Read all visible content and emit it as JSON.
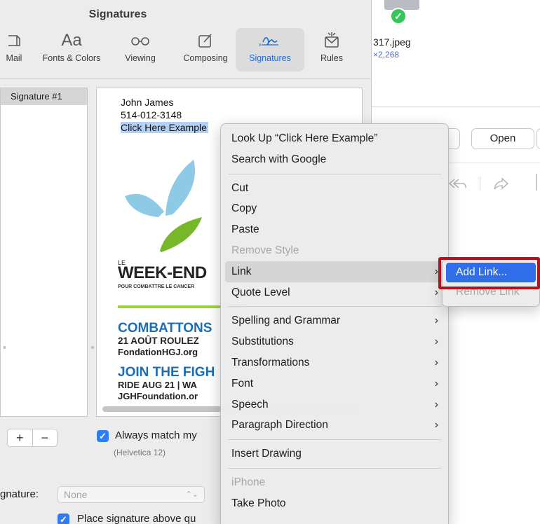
{
  "background": {
    "file_name": "317.jpeg",
    "file_dims": "×2,268",
    "open_button": "Open"
  },
  "prefs": {
    "title": "Signatures",
    "toolbar": {
      "mail": "Mail",
      "fonts": "Fonts & Colors",
      "viewing": "Viewing",
      "composing": "Composing",
      "signatures": "Signatures",
      "rules": "Rules"
    },
    "sig_list": [
      "Signature #1"
    ],
    "signature": {
      "name": "John James",
      "phone": "514-012-3148",
      "link_text": "Click Here Example"
    },
    "logo": {
      "le": "LE",
      "weekend": "WEEK-END",
      "pour": "POUR COMBATTRE LE CANCER",
      "combattons": "COMBATTONS",
      "aout": "21 AOÛT ROULEZ",
      "fondation": "FondationHGJ.org",
      "join": "JOIN THE FIGH",
      "ride": "RIDE AUG 21 | WA",
      "jgh": "JGHFoundation.or"
    },
    "list_buttons": {
      "add": "+",
      "remove": "−"
    },
    "always_match": {
      "label": "Always match my",
      "sub": "(Helvetica 12)",
      "checked": true
    },
    "choose": {
      "label": "gnature:",
      "value": "None"
    },
    "place_above": {
      "label": "Place signature above qu",
      "checked": true
    }
  },
  "context_menu": {
    "items": [
      {
        "label": "Look Up “Click Here Example”"
      },
      {
        "label": "Search with Google"
      },
      {
        "sep": true
      },
      {
        "label": "Cut"
      },
      {
        "label": "Copy"
      },
      {
        "label": "Paste"
      },
      {
        "label": "Remove Style",
        "disabled": true
      },
      {
        "label": "Link",
        "submenu": true,
        "highlighted": true
      },
      {
        "label": "Quote Level",
        "submenu": true
      },
      {
        "sep": true
      },
      {
        "label": "Spelling and Grammar",
        "submenu": true
      },
      {
        "label": "Substitutions",
        "submenu": true
      },
      {
        "label": "Transformations",
        "submenu": true
      },
      {
        "label": "Font",
        "submenu": true
      },
      {
        "label": "Speech",
        "submenu": true
      },
      {
        "label": "Paragraph Direction",
        "submenu": true
      },
      {
        "sep": true
      },
      {
        "label": "Insert Drawing"
      },
      {
        "sep": true
      },
      {
        "label": "iPhone",
        "disabled": true
      },
      {
        "label": "Take Photo"
      }
    ]
  },
  "submenu": {
    "add_link": "Add Link...",
    "remove_link": "Remove Link"
  },
  "colors": {
    "accent": "#2f6ee8",
    "highlight_box": "#b1121c",
    "selection": "#b3d1f5",
    "logo_blue": "#1c6db3",
    "logo_green": "#9fd13a"
  }
}
